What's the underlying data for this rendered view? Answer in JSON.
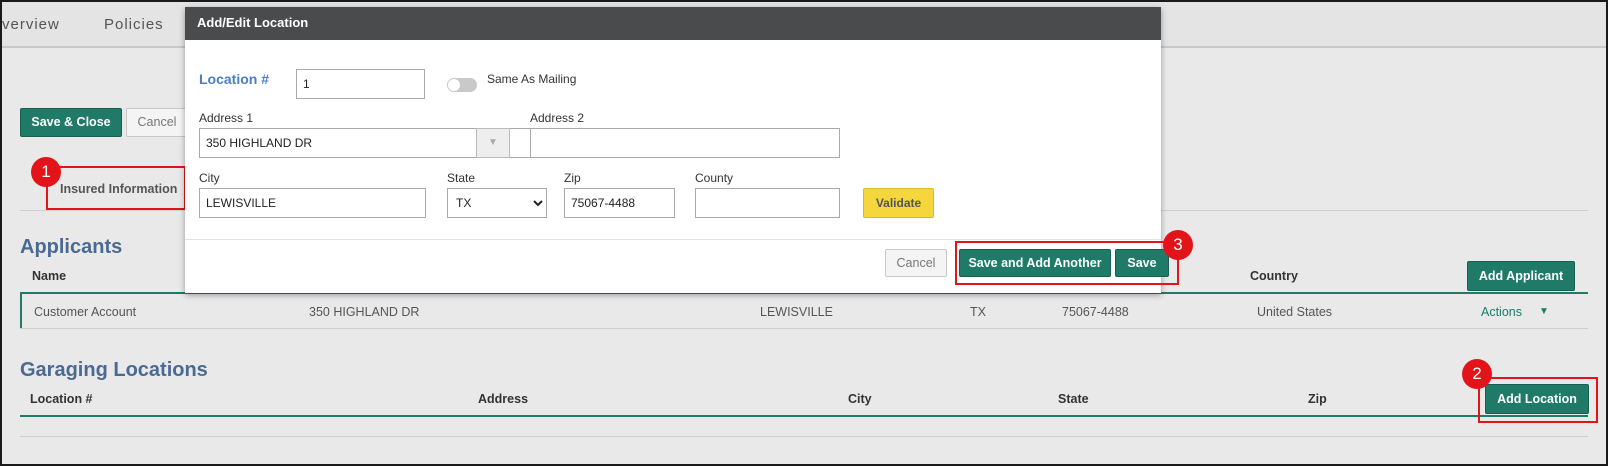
{
  "topnav": {
    "tabs": [
      "verview",
      "Policies"
    ]
  },
  "page": {
    "save_close_label": "Save & Close",
    "cancel_label": "Cancel",
    "insured_info_tab": "Insured Information"
  },
  "applicants": {
    "title": "Applicants",
    "headers": {
      "name": "Name",
      "country": "Country"
    },
    "add_button": "Add Applicant",
    "row": {
      "name": "Customer Account",
      "address": "350 HIGHLAND DR",
      "city": "LEWISVILLE",
      "state": "TX",
      "zip": "75067-4488",
      "country": "United States",
      "actions": "Actions"
    }
  },
  "garaging": {
    "title": "Garaging Locations",
    "headers": {
      "location": "Location #",
      "address": "Address",
      "city": "City",
      "state": "State",
      "zip": "Zip"
    },
    "add_button": "Add Location"
  },
  "modal": {
    "title": "Add/Edit Location",
    "location_label": "Location #",
    "location_value": "1",
    "same_as_mailing": "Same As Mailing",
    "address1_label": "Address 1",
    "address1_value": "350 HIGHLAND DR",
    "address2_label": "Address 2",
    "address2_value": "",
    "city_label": "City",
    "city_value": "LEWISVILLE",
    "state_label": "State",
    "state_value": "TX",
    "zip_label": "Zip",
    "zip_value": "75067-4488",
    "county_label": "County",
    "county_value": "",
    "validate": "Validate",
    "cancel": "Cancel",
    "save_add_another": "Save and Add Another",
    "save": "Save"
  },
  "annotations": {
    "badge1": "1",
    "badge2": "2",
    "badge3": "3"
  },
  "colors": {
    "accent": "#1f7a68",
    "title_blue": "#4a6a93",
    "annotation_red": "#e2141a",
    "validate_yellow": "#f5d63c"
  }
}
